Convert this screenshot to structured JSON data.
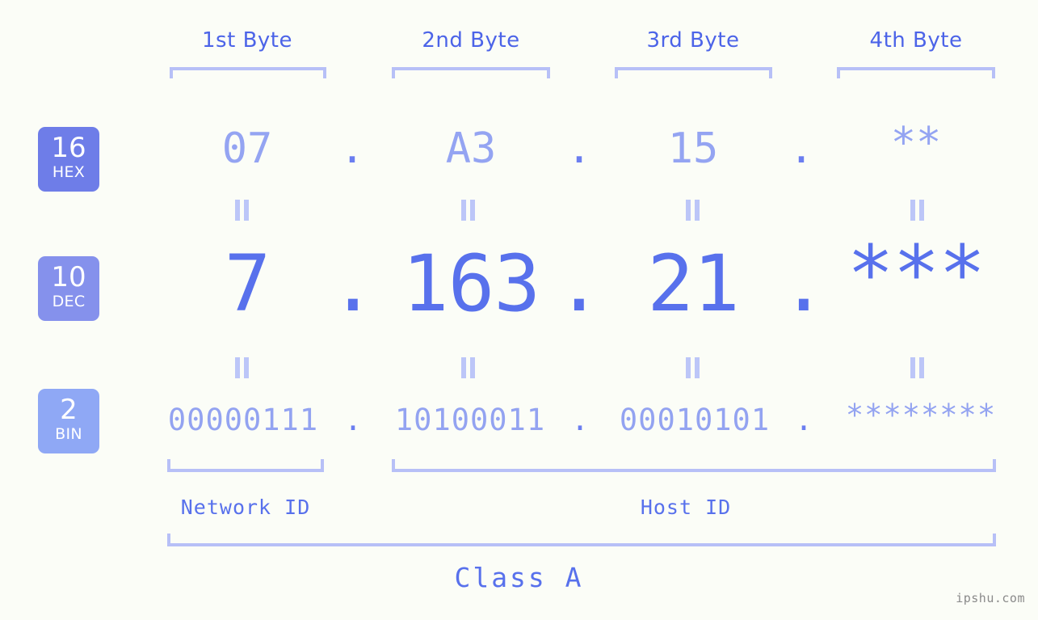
{
  "page": {
    "background_color": "#fbfdf7",
    "accent_color": "#5871ec",
    "bracket_color": "#b7c0f7",
    "watermark": "ipshu.com"
  },
  "byte_headers": [
    {
      "label": "1st Byte"
    },
    {
      "label": "2nd Byte"
    },
    {
      "label": "3rd Byte"
    },
    {
      "label": "4th Byte"
    }
  ],
  "rows": [
    {
      "id": "hex",
      "badge_number": "16",
      "badge_word": "HEX",
      "badge_color": "#6e7de8",
      "values": [
        "07",
        "A3",
        "15",
        "**"
      ],
      "separators": [
        ".",
        ".",
        "."
      ]
    },
    {
      "id": "dec",
      "badge_number": "10",
      "badge_word": "DEC",
      "badge_color": "#8591ec",
      "values": [
        "7",
        "163",
        "21",
        "***"
      ],
      "separators": [
        ".",
        ".",
        "."
      ]
    },
    {
      "id": "bin",
      "badge_number": "2",
      "badge_word": "BIN",
      "badge_color": "#8fa8f5",
      "values": [
        "00000111",
        "10100011",
        "00010101",
        "********"
      ],
      "separators": [
        ".",
        ".",
        "."
      ]
    }
  ],
  "equals_glyph": "||",
  "footer": {
    "network_id_label": "Network ID",
    "host_id_label": "Host ID",
    "class_label": "Class A"
  }
}
